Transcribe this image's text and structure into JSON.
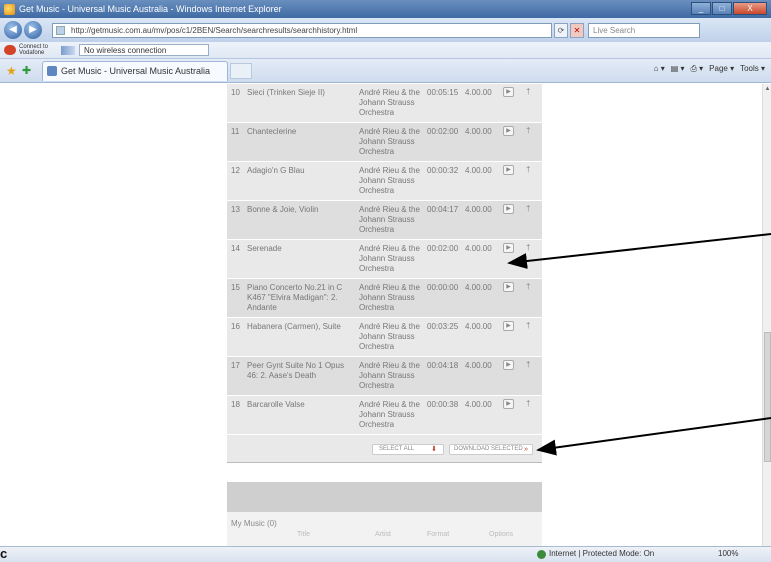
{
  "window": {
    "title": "Get Music - Universal Music Australia - Windows Internet Explorer",
    "controls": [
      "_",
      "□",
      "X"
    ]
  },
  "address_bar": {
    "url": "http://getmusic.com.au/mv/pos/c1/2BEN/Search/searchresults/searchhistory.html",
    "search_placeholder": "Live Search"
  },
  "links_bar": {
    "connection_label": "Connect to Vodafone",
    "wifi_label": "No wireless connection"
  },
  "tab": {
    "label": "Get Music - Universal Music Australia"
  },
  "toolbar": {
    "page": "Page ▾",
    "tools": "Tools ▾"
  },
  "tracks": [
    {
      "num": "10",
      "title": "Sieci (Trinken Sieje II)",
      "artist": "André Rieu & the Johann Strauss Orchestra",
      "duration": "00:05:15",
      "price": "4.00.00"
    },
    {
      "num": "11",
      "title": "Chanteclerine",
      "artist": "André Rieu & the Johann Strauss Orchestra",
      "duration": "00:02:00",
      "price": "4.00.00"
    },
    {
      "num": "12",
      "title": "Adagio'n G Blau",
      "artist": "André Rieu & the Johann Strauss Orchestra",
      "duration": "00:00:32",
      "price": "4.00.00"
    },
    {
      "num": "13",
      "title": "Bonne & Joie, Violin",
      "artist": "André Rieu & the Johann Strauss Orchestra",
      "duration": "00:04:17",
      "price": "4.00.00"
    },
    {
      "num": "14",
      "title": "Serenade",
      "artist": "André Rieu & the Johann Strauss Orchestra",
      "duration": "00:02:00",
      "price": "4.00.00"
    },
    {
      "num": "15",
      "title": "Piano Concerto No.21 in C K467 \"Elvira Madigan\": 2. Andante",
      "artist": "André Rieu & the Johann Strauss Orchestra",
      "duration": "00:00:00",
      "price": "4.00.00"
    },
    {
      "num": "16",
      "title": "Habanera (Carmen), Suite",
      "artist": "André Rieu & the Johann Strauss Orchestra",
      "duration": "00:03:25",
      "price": "4.00.00"
    },
    {
      "num": "17",
      "title": "Peer Gynt Suite No 1 Opus 46: 2. Aase's Death",
      "artist": "André Rieu & the Johann Strauss Orchestra",
      "duration": "00:04:18",
      "price": "4.00.00"
    },
    {
      "num": "18",
      "title": "Barcarolle Valse",
      "artist": "André Rieu & the Johann Strauss Orchestra",
      "duration": "00:00:38",
      "price": "4.00.00"
    }
  ],
  "buttons": {
    "select_all": "SELECT ALL",
    "download_selected": "DOWNLOAD SELECTED"
  },
  "my_music": {
    "title": "My Music (0)",
    "headers": [
      "Title",
      "Artist",
      "Format",
      "Options"
    ]
  },
  "status": {
    "left_mark": "c",
    "zone": "Internet | Protected Mode: On",
    "zoom": "100%"
  },
  "colors": {
    "title_bar": "#3f6aa3",
    "panel": "#e9e9e9",
    "accent_red": "#c0392b"
  }
}
